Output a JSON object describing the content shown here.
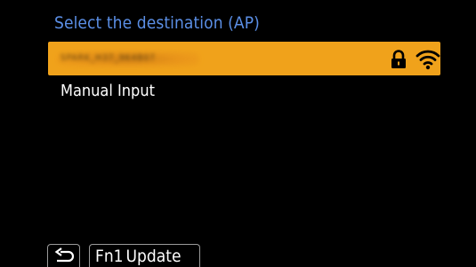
{
  "screen": {
    "title": "Select the destination (AP)",
    "colors": {
      "background": "#000000",
      "title": "#5b8fe6",
      "selected_row": "#f0a21b",
      "text": "#ffffff",
      "button_border": "#9a9a9a"
    }
  },
  "access_points": [
    {
      "ssid": "SPARK_H37_9K4B07",
      "ssid_blurred": true,
      "selected": true,
      "secured": true,
      "lock_icon": "lock-icon",
      "signal_icon": "wifi-signal-icon"
    }
  ],
  "menu": {
    "manual_input_label": "Manual Input"
  },
  "footer": {
    "back_icon": "return-arrow-icon",
    "fn_key": "Fn1",
    "fn_action": "Update"
  }
}
